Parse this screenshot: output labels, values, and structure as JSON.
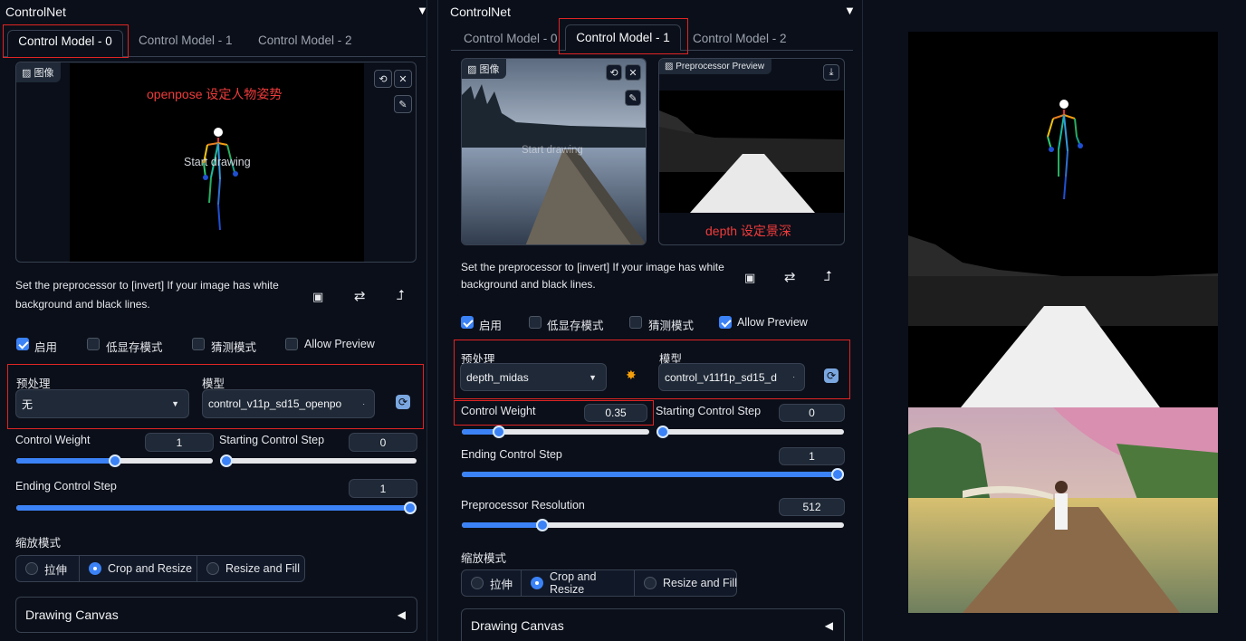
{
  "panels": [
    {
      "title": "ControlNet",
      "collapse_icon": "triangle-down-icon",
      "tabs": [
        "Control Model - 0",
        "Control Model - 1",
        "Control Model - 2"
      ],
      "active_tab": 0,
      "image_label": "图像",
      "canvas_note": "openpose 设定人物姿势",
      "canvas_hint": "Start drawing",
      "note_line1": "Set the preprocessor to [invert] If your image has white",
      "note_line2": "background and black lines.",
      "checkboxes": [
        {
          "label": "启用",
          "checked": true
        },
        {
          "label": "低显存模式",
          "checked": false
        },
        {
          "label": "猜测模式",
          "checked": false
        },
        {
          "label": "Allow Preview",
          "checked": false
        }
      ],
      "preprocessor_label": "预处理",
      "preprocessor_value": "无",
      "model_label": "模型",
      "model_value": "control_v11p_sd15_openpo",
      "control_weight_label": "Control Weight",
      "control_weight": "1",
      "starting_step_label": "Starting Control Step",
      "starting_step": "0",
      "ending_step_label": "Ending Control Step",
      "ending_step": "1",
      "resize_mode_label": "缩放模式",
      "resize_options": [
        "拉伸",
        "Crop and Resize",
        "Resize and Fill"
      ],
      "resize_selected": 1,
      "drawing_canvas": "Drawing Canvas"
    },
    {
      "title": "ControlNet",
      "collapse_icon": "triangle-down-icon",
      "tabs": [
        "Control Model - 0",
        "Control Model - 1",
        "Control Model - 2"
      ],
      "active_tab": 1,
      "image_label": "图像",
      "canvas_hint": "Start drawing",
      "preview_label": "Preprocessor Preview",
      "preview_note": "depth 设定景深",
      "note_line1": "Set the preprocessor to [invert] If your image has white",
      "note_line2": "background and black lines.",
      "checkboxes": [
        {
          "label": "启用",
          "checked": true
        },
        {
          "label": "低显存模式",
          "checked": false
        },
        {
          "label": "猜测模式",
          "checked": false
        },
        {
          "label": "Allow Preview",
          "checked": true
        }
      ],
      "preprocessor_label": "预处理",
      "preprocessor_value": "depth_midas",
      "model_label": "模型",
      "model_value": "control_v11f1p_sd15_d",
      "control_weight_label": "Control Weight",
      "control_weight": "0.35",
      "starting_step_label": "Starting Control Step",
      "starting_step": "0",
      "ending_step_label": "Ending Control Step",
      "ending_step": "1",
      "resolution_label": "Preprocessor Resolution",
      "resolution": "512",
      "resize_mode_label": "缩放模式",
      "resize_options": [
        "拉伸",
        "Crop and Resize",
        "Resize and Fill"
      ],
      "resize_selected": 1,
      "drawing_canvas": "Drawing Canvas"
    }
  ],
  "sliders": {
    "p0_weight": 0.5,
    "p0_start": 0.0,
    "p0_end": 1.0,
    "p1_weight": 0.175,
    "p1_start": 0.0,
    "p1_end": 1.0,
    "p1_resolution": 0.2
  },
  "icons": {
    "undo": "undo-icon",
    "close": "close-icon",
    "brush": "brush-icon",
    "camera": "camera-icon",
    "swap": "swap-icon",
    "send": "send-up-icon",
    "refresh": "refresh-icon",
    "explode": "run-preprocessor-icon",
    "download": "download-icon"
  },
  "colors": {
    "accent": "#3b82f6",
    "annotation": "#e02424",
    "background": "#0b0f19"
  }
}
